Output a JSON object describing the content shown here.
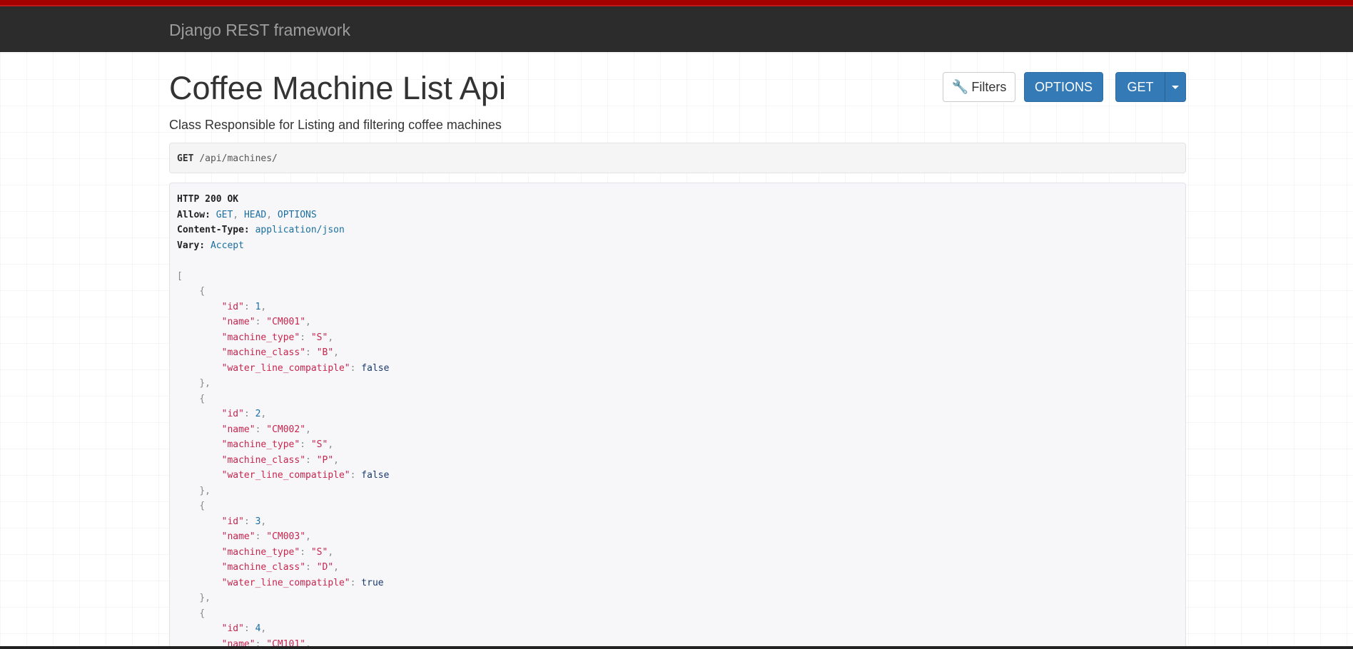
{
  "navbar": {
    "brand": "Django REST framework"
  },
  "page": {
    "title": "Coffee Machine List Api",
    "description": "Class Responsible for Listing and filtering coffee machines"
  },
  "toolbar": {
    "filters_label": "Filters",
    "options_label": "OPTIONS",
    "get_label": "GET",
    "filters_icon": "wrench-icon",
    "get_dropdown_icon": "caret-down-icon"
  },
  "request": {
    "method": "GET",
    "path": "/api/machines/"
  },
  "response": {
    "status": "HTTP 200 OK",
    "headers": {
      "allow_name": "Allow:",
      "allow_values": [
        "GET",
        "HEAD",
        "OPTIONS"
      ],
      "content_type_name": "Content-Type:",
      "content_type_value": "application/json",
      "vary_name": "Vary:",
      "vary_value": "Accept"
    },
    "items": [
      {
        "id": "1",
        "name": "\"CM001\"",
        "machine_type": "\"S\"",
        "machine_class": "\"B\"",
        "water_line_compatiple": "false"
      },
      {
        "id": "2",
        "name": "\"CM002\"",
        "machine_type": "\"S\"",
        "machine_class": "\"P\"",
        "water_line_compatiple": "false"
      },
      {
        "id": "3",
        "name": "\"CM003\"",
        "machine_type": "\"S\"",
        "machine_class": "\"D\"",
        "water_line_compatiple": "true"
      },
      {
        "id": "4",
        "name": "\"CM101\""
      }
    ],
    "keys": {
      "id": "\"id\"",
      "name": "\"name\"",
      "machine_type": "\"machine_type\"",
      "machine_class": "\"machine_class\"",
      "water_line_compatiple": "\"water_line_compatiple\""
    }
  },
  "colors": {
    "navbar_bg": "#2c2c2c",
    "navbar_accent": "#a30000",
    "primary": "#337ab7",
    "json_key": "#c7254e",
    "json_value": "#1a6ea0"
  }
}
